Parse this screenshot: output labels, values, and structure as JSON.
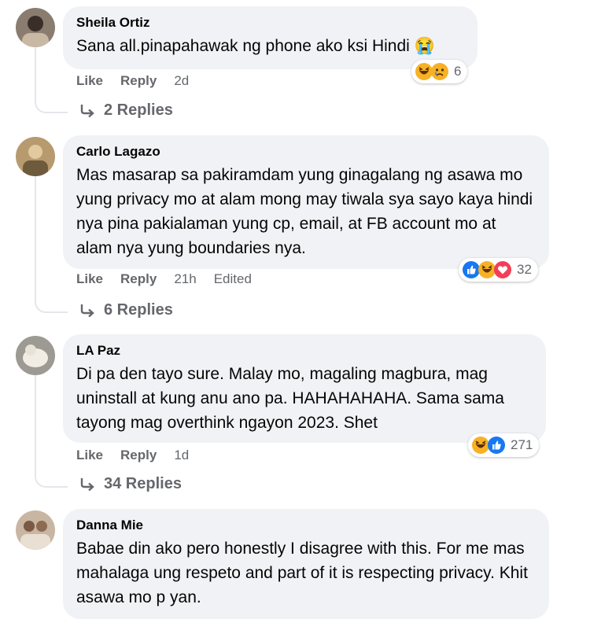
{
  "comments": [
    {
      "author": "Sheila Ortiz",
      "text": "Sana all.pinapahawak ng phone ako ksi Hindi 😭",
      "like_label": "Like",
      "reply_label": "Reply",
      "time": "2d",
      "edited": "",
      "reaction_icons": [
        "haha-reaction-icon",
        "sad-reaction-icon"
      ],
      "reaction_count": "6",
      "replies_label": "2 Replies"
    },
    {
      "author": "Carlo Lagazo",
      "text": "Mas masarap sa pakiramdam yung ginagalang ng asawa mo yung privacy mo at alam mong may tiwala sya sayo kaya hindi nya pina pakialaman yung cp, email, at FB account mo at alam nya yung boundaries nya.",
      "like_label": "Like",
      "reply_label": "Reply",
      "time": "21h",
      "edited": "Edited",
      "reaction_icons": [
        "like-reaction-icon",
        "haha-reaction-icon",
        "love-reaction-icon"
      ],
      "reaction_count": "32",
      "replies_label": "6 Replies"
    },
    {
      "author": "LA Paz",
      "text": "Di pa den tayo sure. Malay mo, magaling magbura, mag uninstall at kung anu ano pa. HAHAHAHAHA. Sama sama tayong mag overthink ngayon 2023. Shet",
      "like_label": "Like",
      "reply_label": "Reply",
      "time": "1d",
      "edited": "",
      "reaction_icons": [
        "haha-reaction-icon",
        "like-reaction-icon"
      ],
      "reaction_count": "271",
      "replies_label": "34 Replies"
    },
    {
      "author": "Danna Mie",
      "text": "Babae din ako pero honestly I disagree with this. For me mas mahalaga ung respeto and part of it is respecting privacy. Khit asawa mo p yan."
    }
  ],
  "colors": {
    "bubble_bg": "#f0f2f5",
    "meta_text": "#65676b",
    "like_blue": "#1877f2",
    "love_red": "#f33e58",
    "haha_yellow": "#f7b125"
  }
}
